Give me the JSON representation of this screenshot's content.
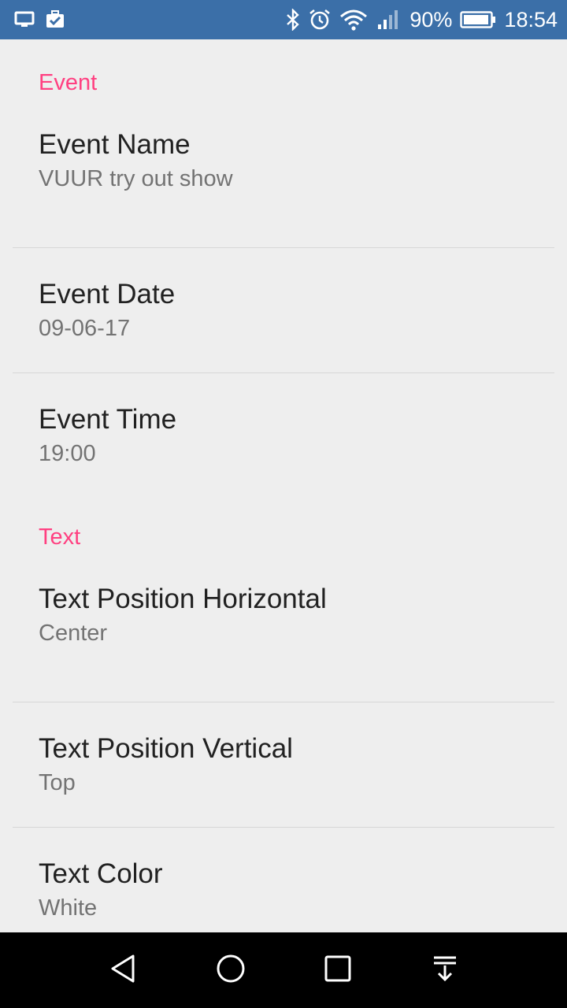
{
  "status_bar": {
    "battery_percent": "90%",
    "time": "18:54",
    "icons_left": [
      "screen-icon",
      "briefcase-check-icon"
    ],
    "icons_right": [
      "bluetooth-icon",
      "alarm-icon",
      "wifi-icon",
      "signal-icon",
      "battery-icon"
    ],
    "background": "#3b6fa8"
  },
  "sections": {
    "event": {
      "header": "Event",
      "items": [
        {
          "title": "Event Name",
          "summary": "VUUR try out show"
        },
        {
          "title": "Event Date",
          "summary": "09-06-17"
        },
        {
          "title": "Event Time",
          "summary": "19:00"
        }
      ]
    },
    "text": {
      "header": "Text",
      "items": [
        {
          "title": "Text Position Horizontal",
          "summary": "Center"
        },
        {
          "title": "Text Position Vertical",
          "summary": "Top"
        },
        {
          "title": "Text Color",
          "summary": "White"
        }
      ]
    }
  },
  "colors": {
    "accent": "#ff4081",
    "background": "#eeeeee",
    "title_text": "#212121",
    "summary_text": "#737373"
  },
  "nav_bar": {
    "buttons": [
      "back-icon",
      "home-icon",
      "recents-icon",
      "notification-pull-icon"
    ]
  }
}
